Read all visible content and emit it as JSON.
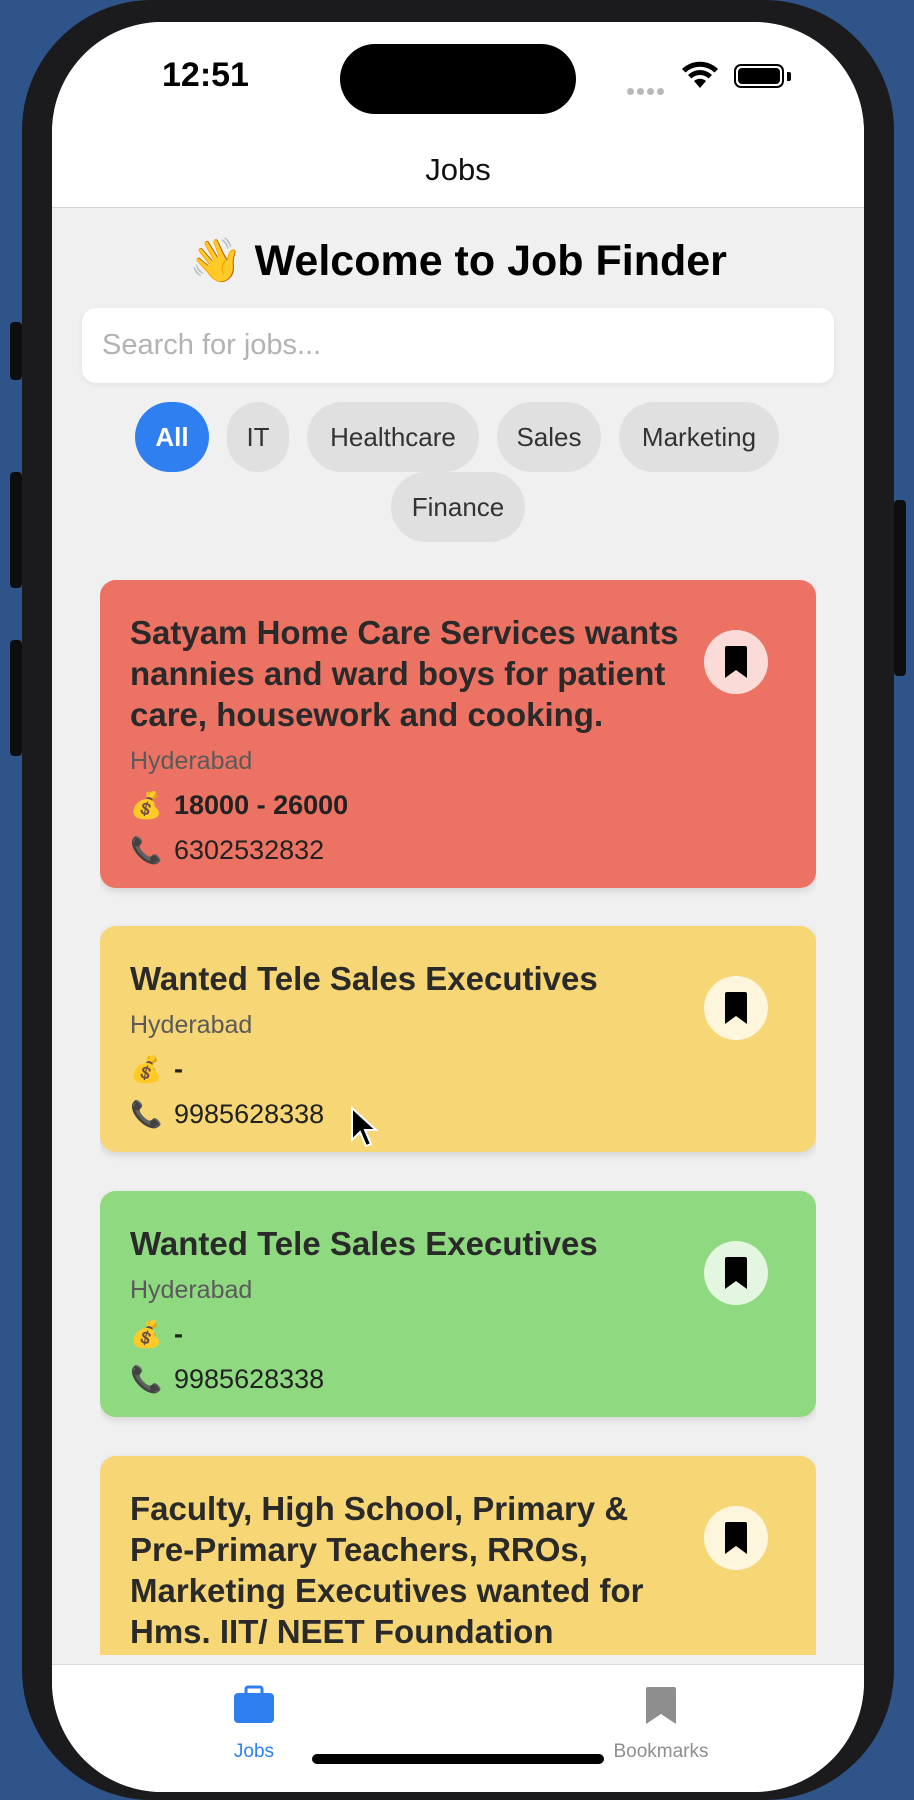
{
  "status_bar": {
    "time": "12:51"
  },
  "nav": {
    "title": "Jobs"
  },
  "welcome": {
    "emoji": "👋",
    "text": "Welcome to Job Finder"
  },
  "search": {
    "placeholder": "Search for jobs...",
    "value": ""
  },
  "categories": [
    {
      "label": "All",
      "active": true
    },
    {
      "label": "IT",
      "active": false
    },
    {
      "label": "Healthcare",
      "active": false
    },
    {
      "label": "Sales",
      "active": false
    },
    {
      "label": "Marketing",
      "active": false
    },
    {
      "label": "Finance",
      "active": false
    }
  ],
  "jobs": [
    {
      "title": "Satyam Home Care Services wants nannies and ward boys for patient care, housework and cooking.",
      "location": "Hyderabad",
      "salary": "18000 - 26000",
      "phone": "6302532832",
      "color": "#ec7263"
    },
    {
      "title": "Wanted Tele Sales Executives",
      "location": "Hyderabad",
      "salary": "-",
      "phone": "9985628338",
      "color": "#f6d675"
    },
    {
      "title": "Wanted Tele Sales Executives",
      "location": "Hyderabad",
      "salary": "-",
      "phone": "9985628338",
      "color": "#8fd981"
    },
    {
      "title": "Faculty, High School, Primary & Pre-Primary Teachers, RROs, Marketing Executives wanted for Hms. IIT/ NEET Foundation",
      "location": "",
      "salary": "",
      "phone": "",
      "color": "#f6d675"
    }
  ],
  "icons": {
    "money": "💰",
    "phone": "📞",
    "bookmark": "bookmark-icon",
    "jobs_tab": "briefcase-icon",
    "bookmarks_tab": "bookmark-icon"
  },
  "tabs": [
    {
      "label": "Jobs",
      "active": true,
      "color": "#2f7ff0"
    },
    {
      "label": "Bookmarks",
      "active": false,
      "color": "#8e8e8e"
    }
  ],
  "colors": {
    "accent": "#2f7ff0",
    "background": "#2f5489"
  }
}
